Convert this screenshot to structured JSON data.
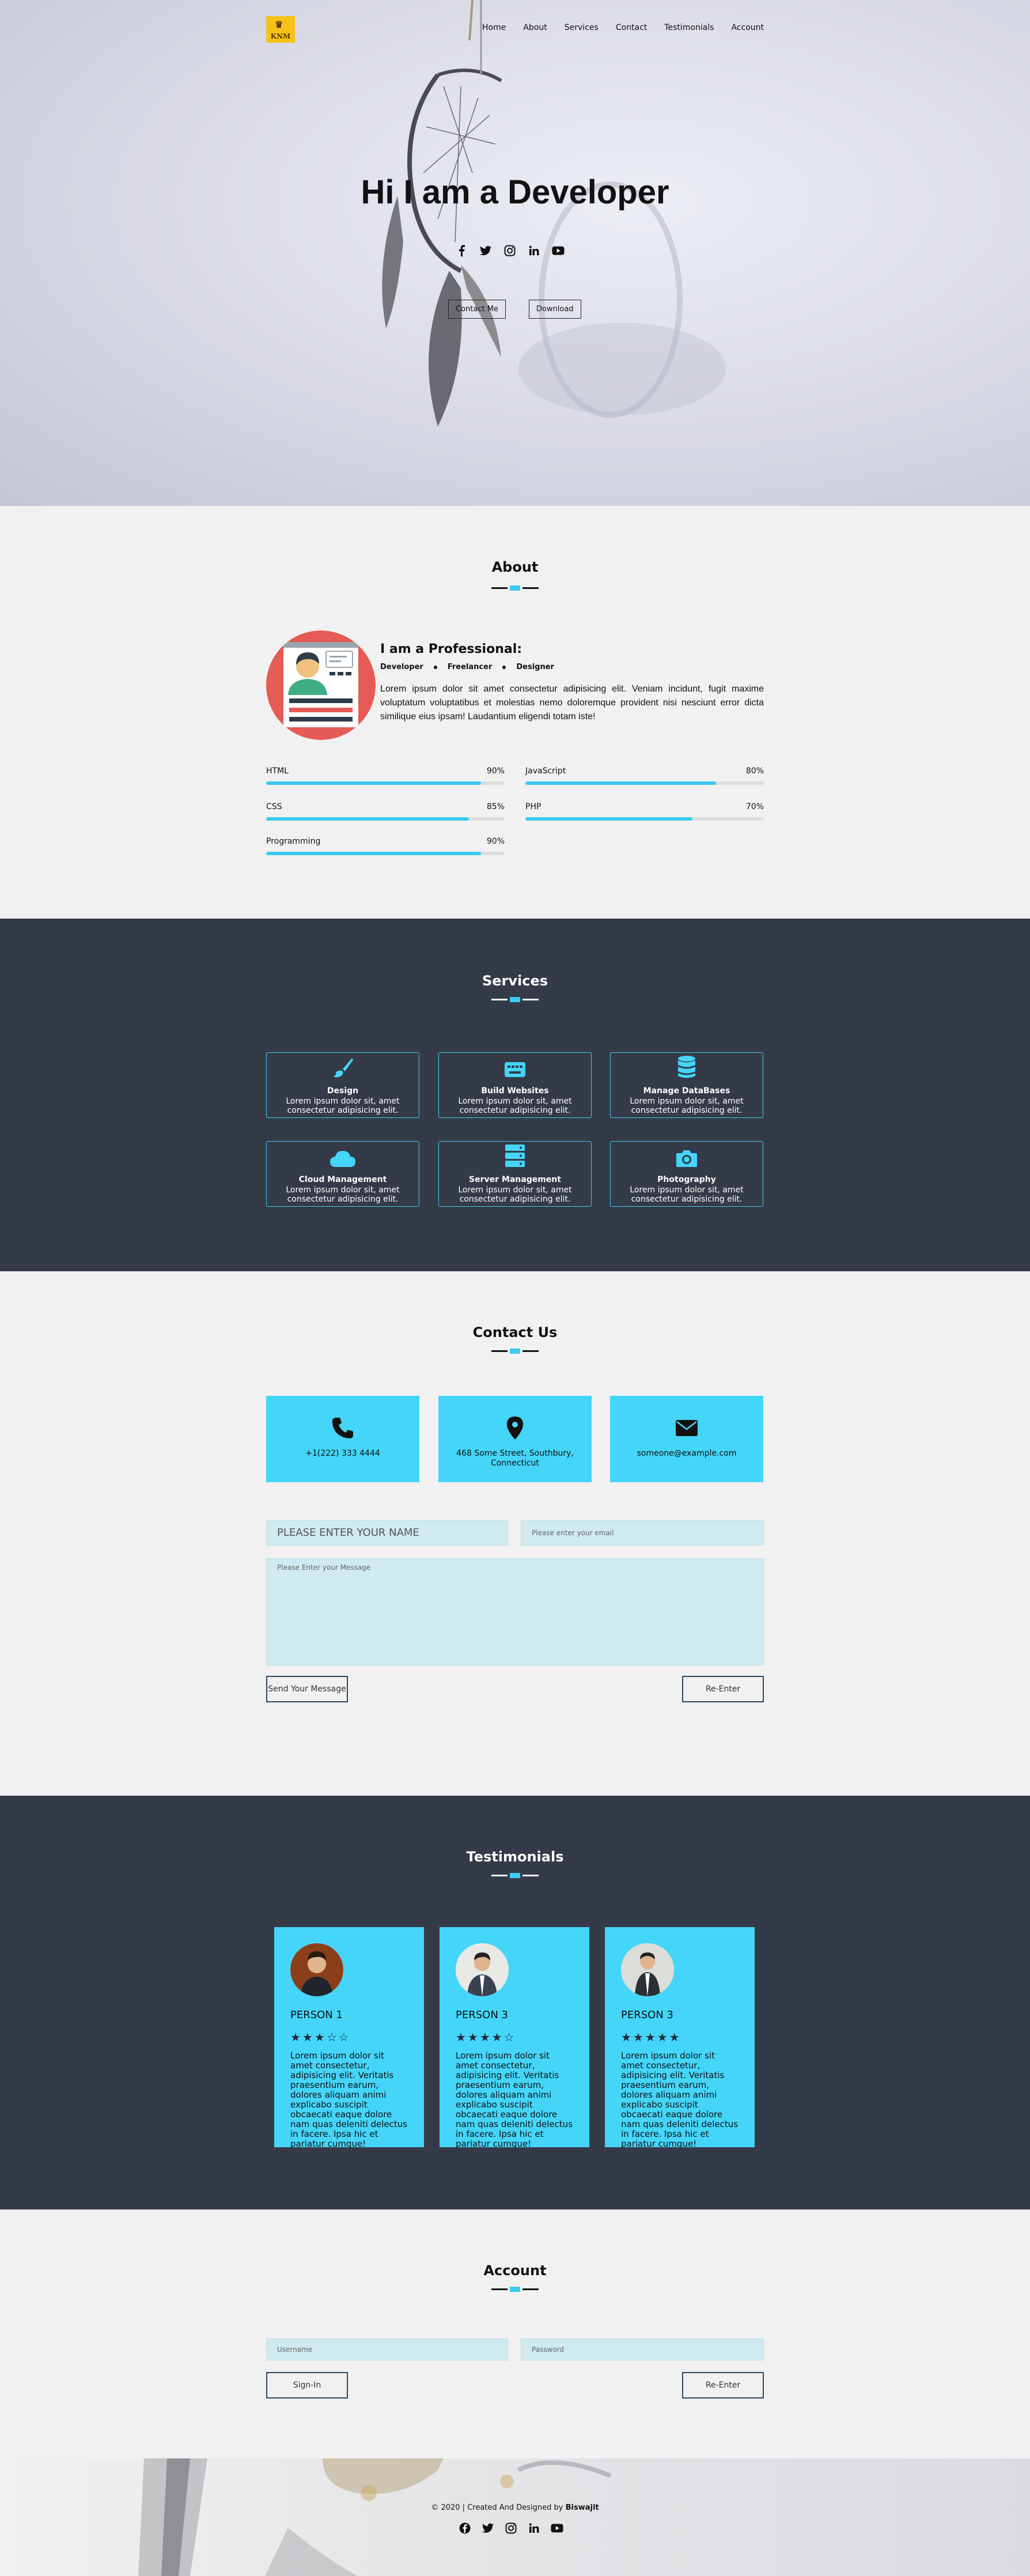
{
  "nav": {
    "logo_text": "KNM",
    "items": [
      "Home",
      "About",
      "Services",
      "Contact",
      "Testimonials",
      "Account"
    ]
  },
  "hero": {
    "title": "Hi I am a Developer",
    "social_icons": [
      "facebook-icon",
      "twitter-icon",
      "instagram-icon",
      "linkedin-icon",
      "youtube-icon"
    ],
    "contact_button": "Contact Me",
    "download_button": "Download"
  },
  "about": {
    "title": "About",
    "heading": "I am a Professional:",
    "tags": [
      "Developer",
      "Freelancer",
      "Designer"
    ],
    "text": "Lorem ipsum dolor sit amet consectetur adipisicing elit. Veniam incidunt, fugit maxime voluptatum voluptatibus et molestias nemo doloremque provident nisi nesciunt error dicta similique eius ipsam! Laudantium eligendi totam iste!",
    "skills": [
      {
        "name": "HTML",
        "percent_text": "90%",
        "value": 90
      },
      {
        "name": "JavaScript",
        "percent_text": "80%",
        "value": 80
      },
      {
        "name": "CSS",
        "percent_text": "85%",
        "value": 85
      },
      {
        "name": "PHP",
        "percent_text": "70%",
        "value": 70
      },
      {
        "name": "Programming",
        "percent_text": "90%",
        "value": 90
      }
    ]
  },
  "services": {
    "title": "Services",
    "items": [
      {
        "name": "Design",
        "desc": "Lorem ipsum dolor sit, amet consectetur adipisicing elit.",
        "icon": "paintbrush-icon"
      },
      {
        "name": "Build Websites",
        "desc": "Lorem ipsum dolor sit, amet consectetur adipisicing elit.",
        "icon": "keyboard-icon"
      },
      {
        "name": "Manage DataBases",
        "desc": "Lorem ipsum dolor sit, amet consectetur adipisicing elit.",
        "icon": "database-icon"
      },
      {
        "name": "Cloud Management",
        "desc": "Lorem ipsum dolor sit, amet consectetur adipisicing elit.",
        "icon": "cloud-icon"
      },
      {
        "name": "Server Management",
        "desc": "Lorem ipsum dolor sit, amet consectetur adipisicing elit.",
        "icon": "server-icon"
      },
      {
        "name": "Photography",
        "desc": "Lorem ipsum dolor sit, amet consectetur adipisicing elit.",
        "icon": "camera-icon"
      }
    ]
  },
  "contact": {
    "title": "Contact Us",
    "phone": "+1(222) 333 4444",
    "address": "468 Some Street, Southbury, Connecticut",
    "email": "someone@example.com",
    "name_placeholder": "PLEASE ENTER YOUR NAME",
    "email_placeholder": "Please enter your email",
    "message_placeholder": "Please Enter your Message",
    "send_button": "Send Your Message",
    "reenter_button": "Re-Enter"
  },
  "testimonials": {
    "title": "Testimonials",
    "items": [
      {
        "name": "PERSON 1",
        "stars": 3,
        "star_text": "★★★☆☆",
        "text": "Lorem ipsum dolor sit amet consectetur, adipisicing elit. Veritatis praesentium earum, dolores aliquam animi explicabo suscipit obcaecati eaque dolore nam quas deleniti delectus in facere. Ipsa hic et pariatur cumque!"
      },
      {
        "name": "PERSON 3",
        "stars": 4,
        "star_text": "★★★★☆",
        "text": "Lorem ipsum dolor sit amet consectetur, adipisicing elit. Veritatis praesentium earum, dolores aliquam animi explicabo suscipit obcaecati eaque dolore nam quas deleniti delectus in facere. Ipsa hic et pariatur cumque!"
      },
      {
        "name": "PERSON 3",
        "stars": 5,
        "star_text": "★★★★★",
        "text": "Lorem ipsum dolor sit amet consectetur, adipisicing elit. Veritatis praesentium earum, dolores aliquam animi explicabo suscipit obcaecati eaque dolore nam quas deleniti delectus in facere. Ipsa hic et pariatur cumque!"
      }
    ]
  },
  "account": {
    "title": "Account",
    "username_placeholder": "Username",
    "password_placeholder": "Password",
    "signin_button": "Sign-In",
    "reenter_button": "Re-Enter"
  },
  "footer": {
    "copy_prefix": "© 2020 | Created And Designed by ",
    "author": "Biswajit",
    "social_icons": [
      "facebook-icon",
      "twitter-icon",
      "instagram-icon",
      "linkedin-icon",
      "youtube-icon"
    ]
  },
  "colors": {
    "accent": "#44d5f9",
    "dark": "#343a48",
    "light": "#f1f1f1",
    "logo": "#f6c21a"
  }
}
